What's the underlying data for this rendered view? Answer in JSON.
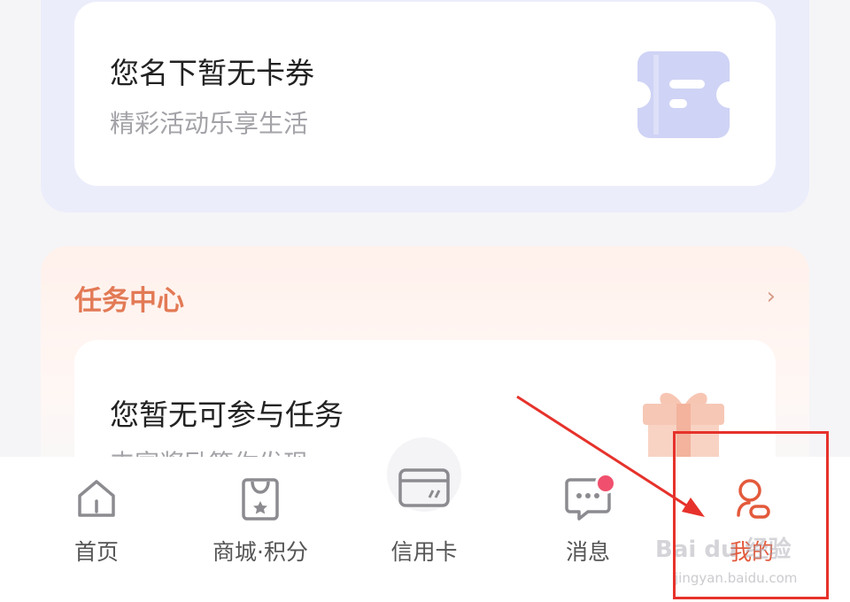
{
  "coupons": {
    "title": "您名下暂无卡券",
    "subtitle": "精彩活动乐享生活",
    "icon": "ticket-icon"
  },
  "tasks": {
    "header": "任务中心",
    "chevron": "›",
    "card_title": "您暂无可参与任务",
    "card_subtitle": "丰富奖励等你发现",
    "icon": "gift-icon"
  },
  "nav": {
    "items": [
      {
        "label": "首页",
        "icon": "home-icon"
      },
      {
        "label": "商城·积分",
        "icon": "shopping-bag-icon"
      },
      {
        "label": "信用卡",
        "icon": "credit-card-icon"
      },
      {
        "label": "消息",
        "icon": "message-icon",
        "badge": true
      },
      {
        "label": "我的",
        "icon": "user-icon",
        "active": true
      }
    ],
    "active_color": "#e35a3c"
  },
  "watermark": {
    "brand": "Bai du 经验",
    "url": "jingyan.baidu.com"
  },
  "colors": {
    "accent": "#e35a3c",
    "task_header": "#e27a55",
    "coupon_bg": "#ecedfb",
    "annotation": "#e6322b"
  }
}
